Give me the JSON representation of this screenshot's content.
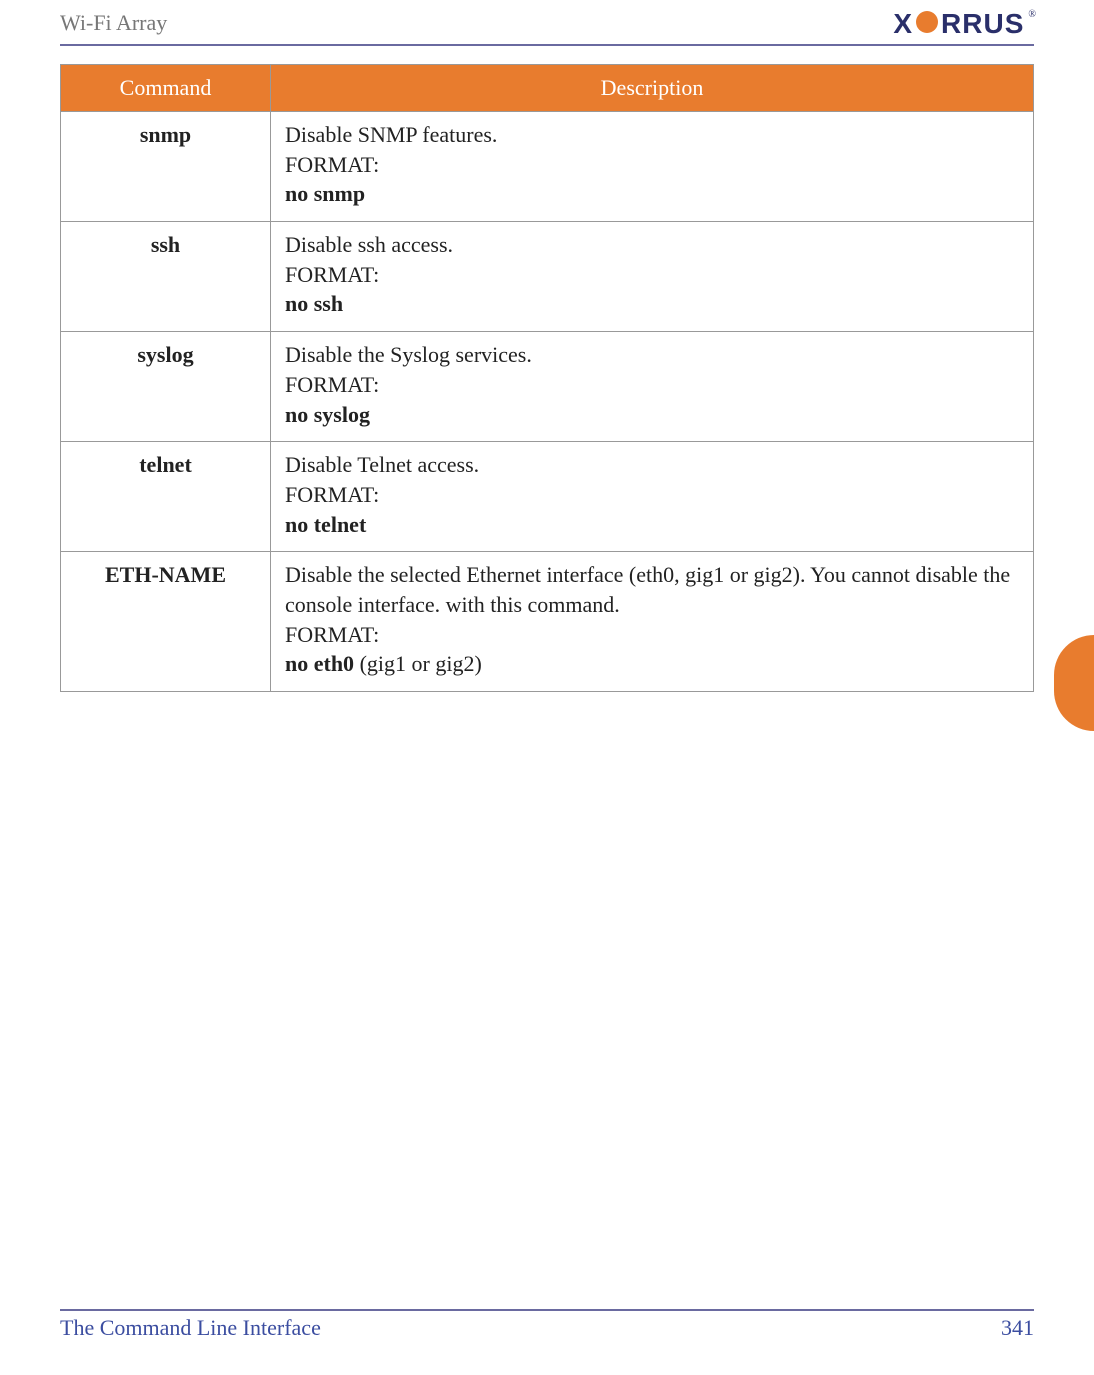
{
  "header": {
    "title": "Wi-Fi Array",
    "logo_pre": "X",
    "logo_post": "RRUS",
    "logo_reg": "®"
  },
  "table": {
    "headers": {
      "command": "Command",
      "description": "Description"
    },
    "rows": [
      {
        "command": "snmp",
        "desc1": "Disable SNMP features.",
        "format_label": "FORMAT:",
        "format_cmd": "no snmp",
        "format_suffix": ""
      },
      {
        "command": "ssh",
        "desc1": "Disable ssh access.",
        "format_label": "FORMAT:",
        "format_cmd": "no ssh",
        "format_suffix": ""
      },
      {
        "command": "syslog",
        "desc1": "Disable the Syslog services.",
        "format_label": "FORMAT:",
        "format_cmd": "no syslog",
        "format_suffix": ""
      },
      {
        "command": "telnet",
        "desc1": "Disable Telnet access.",
        "format_label": "FORMAT:",
        "format_cmd": "no telnet",
        "format_suffix": ""
      },
      {
        "command": "ETH-NAME",
        "desc1": "Disable the selected Ethernet interface (eth0, gig1 or gig2). You cannot disable the console interface. with this command.",
        "format_label": "FORMAT:",
        "format_cmd": "no eth0",
        "format_suffix": " (gig1 or gig2)"
      }
    ]
  },
  "footer": {
    "title": "The Command Line Interface",
    "page": "341"
  }
}
